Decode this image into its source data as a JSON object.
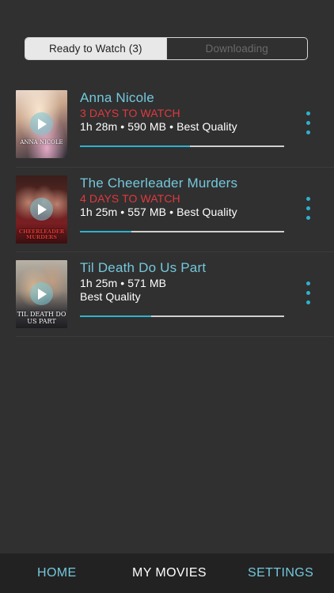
{
  "segments": {
    "ready_label": "Ready to Watch (3)",
    "downloading_label": "Downloading"
  },
  "movies": [
    {
      "poster_caption": "ANNA NICOLE",
      "title": "Anna Nicole",
      "expire": "3 DAYS TO WATCH",
      "meta_line1": "1h 28m • 590 MB • Best Quality",
      "meta_line2": "",
      "progress": 0.54,
      "icon": "more-vertical-icon"
    },
    {
      "poster_caption": "CHEERLEADER MURDERS",
      "title": "The Cheerleader Murders",
      "expire": "4 DAYS TO WATCH",
      "meta_line1": "1h 25m • 557 MB • Best Quality",
      "meta_line2": "",
      "progress": 0.25,
      "icon": "more-vertical-icon"
    },
    {
      "poster_caption": "TIL DEATH DO US PART",
      "title": "Til Death Do Us Part",
      "expire": "",
      "meta_line1": "1h 25m • 571 MB",
      "meta_line2": "Best Quality",
      "progress": 0.35,
      "icon": "more-vertical-icon"
    }
  ],
  "tabbar": {
    "home": "HOME",
    "movies": "MY MOVIES",
    "settings": "SETTINGS"
  },
  "colors": {
    "accent": "#74c8dc",
    "progress": "#2eb2d0",
    "expire": "#e0393e",
    "background": "#303030"
  }
}
